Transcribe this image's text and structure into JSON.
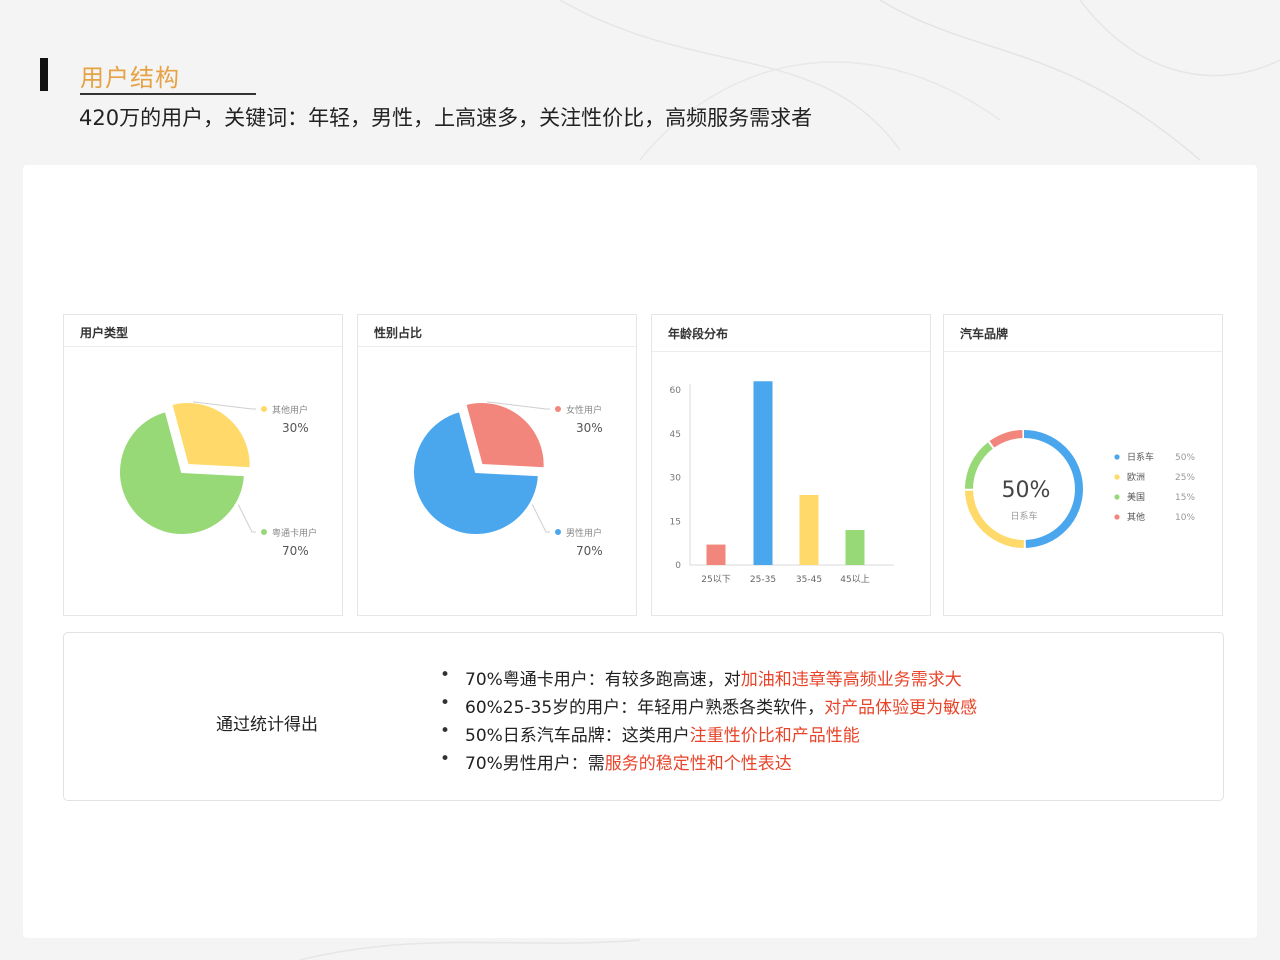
{
  "header": {
    "title": "用户结构",
    "subtitle": "420万的用户，关键词：年轻，男性，上高速多，关注性价比，高频服务需求者"
  },
  "colors": {
    "title": "#e6a244",
    "green": "#97d877",
    "yellow": "#ffd96a",
    "red": "#f2867c",
    "blue": "#4aa6ed",
    "highlight": "#e8442a"
  },
  "chart_data": [
    {
      "type": "pie",
      "title": "用户类型",
      "slices": [
        {
          "label": "其他用户",
          "value": 30,
          "value_label": "30%",
          "color": "#ffd96a",
          "exploded": true
        },
        {
          "label": "粤通卡用户",
          "value": 70,
          "value_label": "70%",
          "color": "#97d877",
          "exploded": false
        }
      ]
    },
    {
      "type": "pie",
      "title": "性别占比",
      "slices": [
        {
          "label": "女性用户",
          "value": 30,
          "value_label": "30%",
          "color": "#f2867c",
          "exploded": true
        },
        {
          "label": "男性用户",
          "value": 70,
          "value_label": "70%",
          "color": "#4aa6ed",
          "exploded": false
        }
      ]
    },
    {
      "type": "bar",
      "title": "年龄段分布",
      "categories": [
        "25以下",
        "25-35",
        "35-45",
        "45以上"
      ],
      "values": [
        7,
        63,
        24,
        12
      ],
      "colors": [
        "#f2867c",
        "#4aa6ed",
        "#ffd96a",
        "#97d877"
      ],
      "yticks": [
        0,
        15,
        30,
        45,
        60
      ],
      "ylim": [
        0,
        60
      ],
      "grid": false
    },
    {
      "type": "pie",
      "donut": true,
      "title": "汽车品牌",
      "center_value": "50%",
      "center_label": "日系车",
      "legend_position": "right",
      "slices": [
        {
          "label": "日系车",
          "value": 50,
          "value_label": "50%",
          "color": "#4aa6ed"
        },
        {
          "label": "欧洲",
          "value": 25,
          "value_label": "25%",
          "color": "#ffd96a"
        },
        {
          "label": "美国",
          "value": 15,
          "value_label": "15%",
          "color": "#97d877"
        },
        {
          "label": "其他",
          "value": 10,
          "value_label": "10%",
          "color": "#f2867c"
        }
      ]
    }
  ],
  "summary": {
    "label": "通过统计得出",
    "bullets": [
      {
        "normal": "70%粤通卡用户：有较多跑高速，对",
        "highlight": "加油和违章等高频业务需求大"
      },
      {
        "normal": "60%25-35岁的用户：年轻用户熟悉各类软件，",
        "highlight": "对产品体验更为敏感"
      },
      {
        "normal": "50%日系汽车品牌：这类用户",
        "highlight": "注重性价比和产品性能"
      },
      {
        "normal": "70%男性用户：需",
        "highlight": "服务的稳定性和个性表达"
      }
    ]
  }
}
